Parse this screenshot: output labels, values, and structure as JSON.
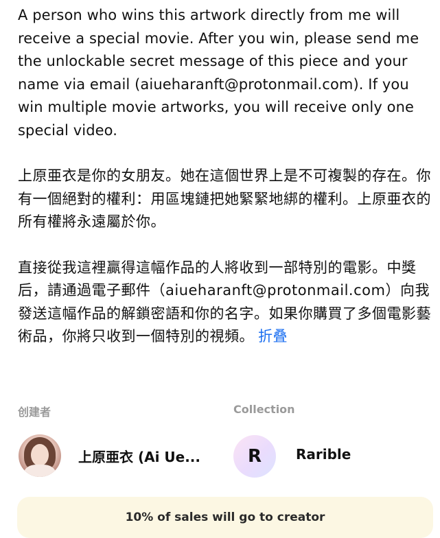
{
  "description": {
    "paragraph_en": "A person who wins this artwork directly from me will receive a special movie. After you win, please send me the unlockable secret message of this piece and your name via email (aiueharanft@protonmail.com). If you win multiple movie artworks, you will receive only one special video.",
    "paragraph_zh_1": "上原亜衣是你的女朋友。她在這個世界上是不可複製的存在。你有一個絕對的權利：用區塊鏈把她緊緊地綁的權利。上原亜衣的所有權將永遠屬於你。",
    "paragraph_zh_2": "直接從我這裡贏得這幅作品的人將收到一部特別的電影。中獎后，請通過電子郵件（aiueharanft@protonmail.com）向我發送這幅作品的解鎖密語和你的名字。如果你購買了多個電影藝術品，你將只收到一個特別的視頻。",
    "collapse_label": "折叠"
  },
  "creator": {
    "label": "创建者",
    "name": "上原亜衣 (Ai Ue..."
  },
  "collection": {
    "label": "Collection",
    "icon_letter": "R",
    "name": "Rarible"
  },
  "royalty": {
    "text": "10% of sales will go to creator"
  },
  "colors": {
    "link": "#1a6ef0",
    "label_gray": "#9a9a9a",
    "banner_bg": "#fcf7e3"
  }
}
